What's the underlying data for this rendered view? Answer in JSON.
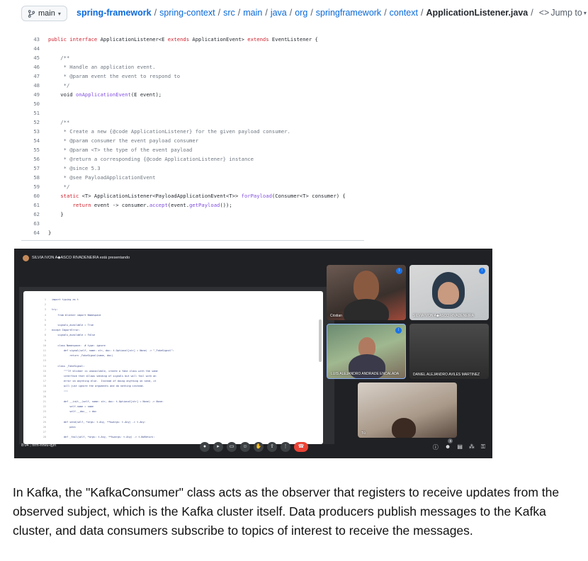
{
  "breadcrumb": {
    "branch": "main",
    "repo": "spring-framework",
    "path": [
      "spring-context",
      "src",
      "main",
      "java",
      "org",
      "springframework",
      "context"
    ],
    "file": "ApplicationListener.java",
    "jump_label": "Jump to"
  },
  "code": [
    {
      "n": "43",
      "t": "public interface ApplicationListener<E extends ApplicationEvent> extends EventListener {"
    },
    {
      "n": "44",
      "t": ""
    },
    {
      "n": "45",
      "t": "    /**"
    },
    {
      "n": "46",
      "t": "     * Handle an application event."
    },
    {
      "n": "47",
      "t": "     * @param event the event to respond to"
    },
    {
      "n": "48",
      "t": "     */"
    },
    {
      "n": "49",
      "t": "    void onApplicationEvent(E event);"
    },
    {
      "n": "50",
      "t": ""
    },
    {
      "n": "51",
      "t": ""
    },
    {
      "n": "52",
      "t": "    /**"
    },
    {
      "n": "53",
      "t": "     * Create a new {@code ApplicationListener} for the given payload consumer."
    },
    {
      "n": "54",
      "t": "     * @param consumer the event payload consumer"
    },
    {
      "n": "55",
      "t": "     * @param <T> the type of the event payload"
    },
    {
      "n": "56",
      "t": "     * @return a corresponding {@code ApplicationListener} instance"
    },
    {
      "n": "57",
      "t": "     * @since 5.3"
    },
    {
      "n": "58",
      "t": "     * @see PayloadApplicationEvent"
    },
    {
      "n": "59",
      "t": "     */"
    },
    {
      "n": "60",
      "t": "    static <T> ApplicationListener<PayloadApplicationEvent<T>> forPayload(Consumer<T> consumer) {"
    },
    {
      "n": "61",
      "t": "        return event -> consumer.accept(event.getPayload());"
    },
    {
      "n": "62",
      "t": "    }"
    },
    {
      "n": "63",
      "t": ""
    },
    {
      "n": "64",
      "t": "}"
    }
  ],
  "meet": {
    "presenter_text": "SILVIA IVON A◆ASCO RIVADENEIRA está presentando",
    "shared_code": [
      {
        "n": "1",
        "t": "import typing as t"
      },
      {
        "n": "2",
        "t": ""
      },
      {
        "n": "3",
        "t": "try:"
      },
      {
        "n": "4",
        "t": "    from blinker import Namespace"
      },
      {
        "n": "5",
        "t": ""
      },
      {
        "n": "6",
        "t": "    signals_available = True"
      },
      {
        "n": "7",
        "t": "except ImportError:"
      },
      {
        "n": "8",
        "t": "    signals_available = False"
      },
      {
        "n": "9",
        "t": ""
      },
      {
        "n": "10",
        "t": "    class Namespace:  # type: ignore"
      },
      {
        "n": "11",
        "t": "        def signal(self, name: str, doc: t.Optional[str] = None) -> \"_FakeSignal\":"
      },
      {
        "n": "12",
        "t": "            return _FakeSignal(name, doc)"
      },
      {
        "n": "13",
        "t": ""
      },
      {
        "n": "14",
        "t": "    class _FakeSignal:"
      },
      {
        "n": "15",
        "t": "        \"\"\"If blinker is unavailable, create a fake class with the same"
      },
      {
        "n": "16",
        "t": "        interface that allows sending of signals but will fail with an"
      },
      {
        "n": "17",
        "t": "        error on anything else.  Instead of doing anything on send, it"
      },
      {
        "n": "18",
        "t": "        will just ignore the arguments and do nothing instead."
      },
      {
        "n": "19",
        "t": "        \"\"\""
      },
      {
        "n": "20",
        "t": ""
      },
      {
        "n": "21",
        "t": "        def __init__(self, name: str, doc: t.Optional[str] = None) -> None:"
      },
      {
        "n": "22",
        "t": "            self.name = name"
      },
      {
        "n": "23",
        "t": "            self.__doc__ = doc"
      },
      {
        "n": "24",
        "t": ""
      },
      {
        "n": "25",
        "t": "        def send(self, *args: t.Any, **kwargs: t.Any) -> t.Any:"
      },
      {
        "n": "26",
        "t": "            pass"
      },
      {
        "n": "27",
        "t": ""
      },
      {
        "n": "28",
        "t": "        def _fail(self, *args: t.Any, **kwargs: t.Any) -> t.NoReturn:"
      }
    ],
    "participants": [
      {
        "name": "Cristian"
      },
      {
        "name": "SILVIA IVON A◆ASCO RIVADENEIRA"
      },
      {
        "name": "LUIS ALEJANDRO ANDRADE ENCALADA"
      },
      {
        "name": "DANIEL ALEJANDRO AVILES MARTINEZ"
      },
      {
        "name": "Tú"
      }
    ],
    "time": "8:04",
    "meeting_code": "nrm-hhvu-qyn",
    "participant_count": "5"
  },
  "paragraph": "In Kafka, the \"KafkaConsumer\" class acts as the observer that registers to receive updates from the observed subject, which is the Kafka cluster itself. Data producers publish messages to the Kafka cluster, and data consumers subscribe to topics of interest to receive the messages."
}
